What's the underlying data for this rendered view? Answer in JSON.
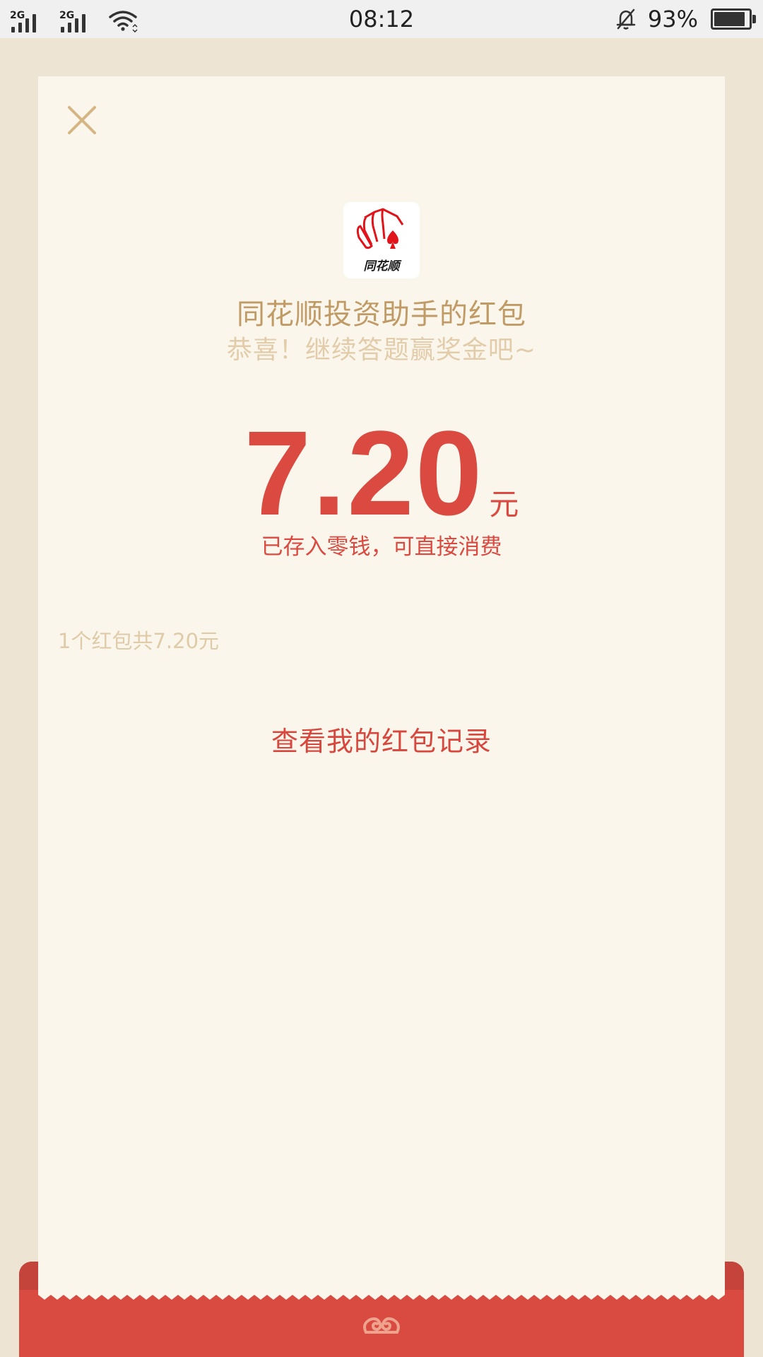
{
  "status_bar": {
    "signal1_type": "2G",
    "signal2_type": "2G",
    "time": "08:12",
    "battery_percent": "93%",
    "battery_level": 0.93
  },
  "red_packet": {
    "logo_text": "同花顺",
    "title": "同花顺投资助手的红包",
    "subtitle": "恭喜！继续答题赢奖金吧~",
    "amount": "7.20",
    "unit": "元",
    "note": "已存入零钱，可直接消费",
    "count_text": "1个红包共7.20元",
    "records_link": "查看我的红包记录"
  },
  "icons": {
    "close": "close-icon",
    "logo": "tonghuashun-logo",
    "emblem": "cloud-emblem-icon"
  },
  "colors": {
    "background": "#ede4d3",
    "card": "#faf6ec",
    "accent_red": "#da4a40",
    "gold": "#c19b66",
    "light_gold": "#e2ccaa"
  }
}
